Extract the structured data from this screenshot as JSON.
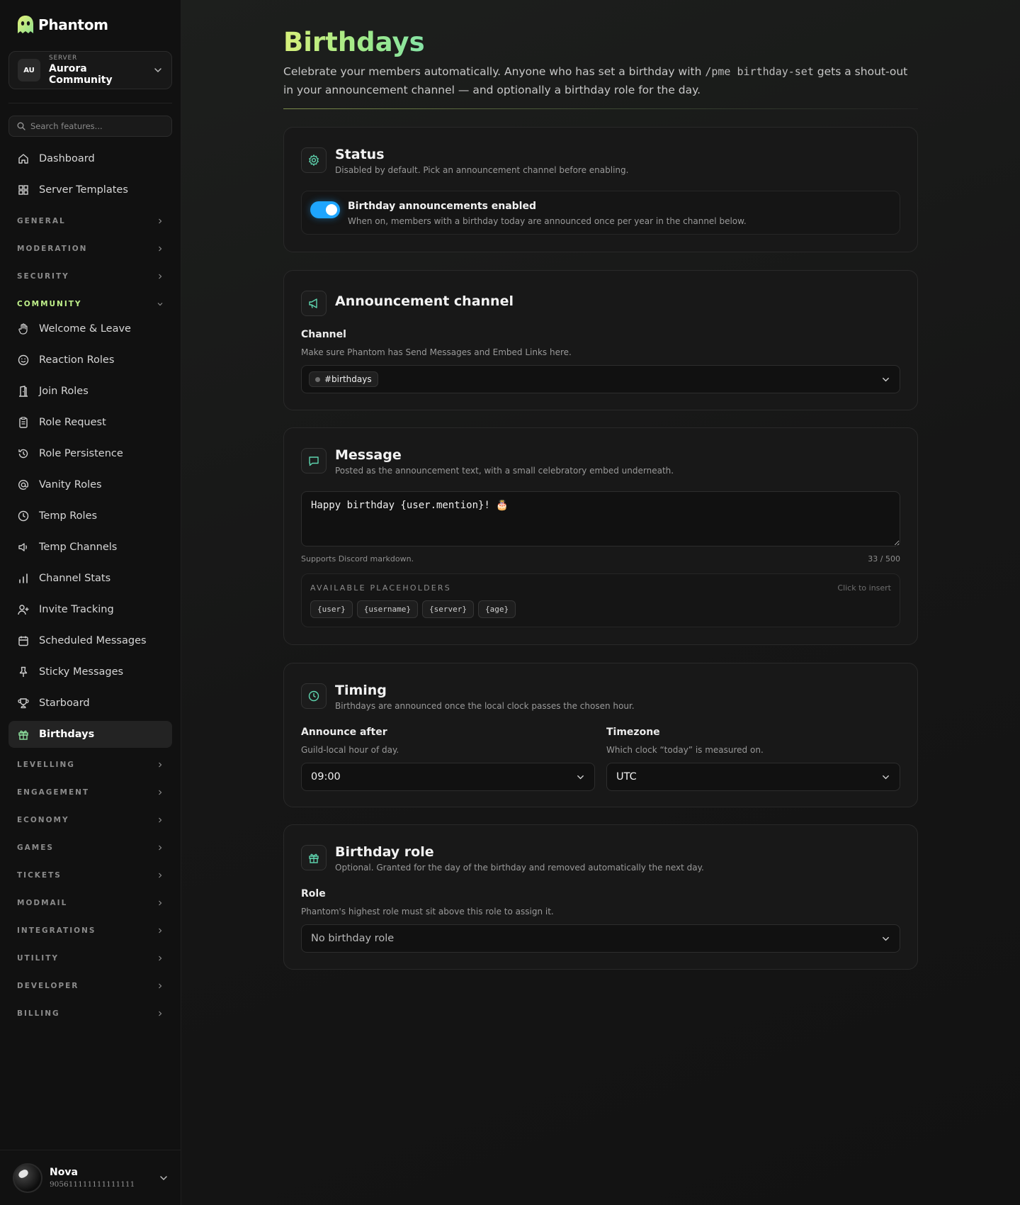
{
  "brand": {
    "name": "Phantom"
  },
  "server": {
    "initials": "AU",
    "caption": "SERVER",
    "name": "Aurora Community"
  },
  "search": {
    "placeholder": "Search features..."
  },
  "nav": {
    "dashboard": "Dashboard",
    "server_templates": "Server Templates",
    "sections": {
      "general": "GENERAL",
      "moderation": "MODERATION",
      "security": "SECURITY",
      "community": "COMMUNITY",
      "levelling": "LEVELLING",
      "engagement": "ENGAGEMENT",
      "economy": "ECONOMY",
      "games": "GAMES",
      "tickets": "TICKETS",
      "modmail": "MODMAIL",
      "integrations": "INTEGRATIONS",
      "utility": "UTILITY",
      "developer": "DEVELOPER",
      "billing": "BILLING"
    },
    "community_items": [
      {
        "label": "Welcome & Leave",
        "icon": "hand-icon"
      },
      {
        "label": "Reaction Roles",
        "icon": "smile-icon"
      },
      {
        "label": "Join Roles",
        "icon": "door-icon"
      },
      {
        "label": "Role Request",
        "icon": "clipboard-icon"
      },
      {
        "label": "Role Persistence",
        "icon": "history-icon"
      },
      {
        "label": "Vanity Roles",
        "icon": "at-sign-icon"
      },
      {
        "label": "Temp Roles",
        "icon": "clock-icon"
      },
      {
        "label": "Temp Channels",
        "icon": "speaker-icon"
      },
      {
        "label": "Channel Stats",
        "icon": "bar-chart-icon"
      },
      {
        "label": "Invite Tracking",
        "icon": "user-plus-icon"
      },
      {
        "label": "Scheduled Messages",
        "icon": "calendar-icon"
      },
      {
        "label": "Sticky Messages",
        "icon": "pin-icon"
      },
      {
        "label": "Starboard",
        "icon": "trophy-icon"
      },
      {
        "label": "Birthdays",
        "icon": "gift-icon"
      }
    ],
    "active": "Birthdays"
  },
  "user": {
    "name": "Nova",
    "id": "905611111111111111"
  },
  "page": {
    "title": "Birthdays",
    "desc_before": "Celebrate your members automatically. Anyone who has set a birthday with ",
    "desc_code": "/pme birthday-set",
    "desc_after": " gets a shout-out in your announcement channel — and optionally a birthday role for the day."
  },
  "status_card": {
    "title": "Status",
    "subtitle": "Disabled by default. Pick an announcement channel before enabling.",
    "toggle_title": "Birthday announcements enabled",
    "toggle_desc": "When on, members with a birthday today are announced once per year in the channel below.",
    "enabled": true
  },
  "channel_card": {
    "title": "Announcement channel",
    "label": "Channel",
    "hint": "Make sure Phantom has Send Messages and Embed Links here.",
    "value": "#birthdays"
  },
  "message_card": {
    "title": "Message",
    "subtitle": "Posted as the announcement text, with a small celebratory embed underneath.",
    "text": "Happy birthday {user.mention}! 🎂",
    "helper": "Supports Discord markdown.",
    "counter": "33 / 500",
    "placeholders_title": "AVAILABLE PLACEHOLDERS",
    "placeholders_hint": "Click to insert",
    "placeholders": [
      "{user}",
      "{username}",
      "{server}",
      "{age}"
    ]
  },
  "timing_card": {
    "title": "Timing",
    "subtitle": "Birthdays are announced once the local clock passes the chosen hour.",
    "announce_label": "Announce after",
    "announce_hint": "Guild-local hour of day.",
    "announce_value": "09:00",
    "tz_label": "Timezone",
    "tz_hint": "Which clock “today” is measured on.",
    "tz_value": "UTC"
  },
  "role_card": {
    "title": "Birthday role",
    "subtitle": "Optional. Granted for the day of the birthday and removed automatically the next day.",
    "label": "Role",
    "hint": "Phantom's highest role must sit above this role to assign it.",
    "value": "No birthday role"
  },
  "colors": {
    "accent_green": "#bff08a",
    "toggle_blue": "#1ea5ff",
    "icon_teal": "#5fd6b0"
  }
}
